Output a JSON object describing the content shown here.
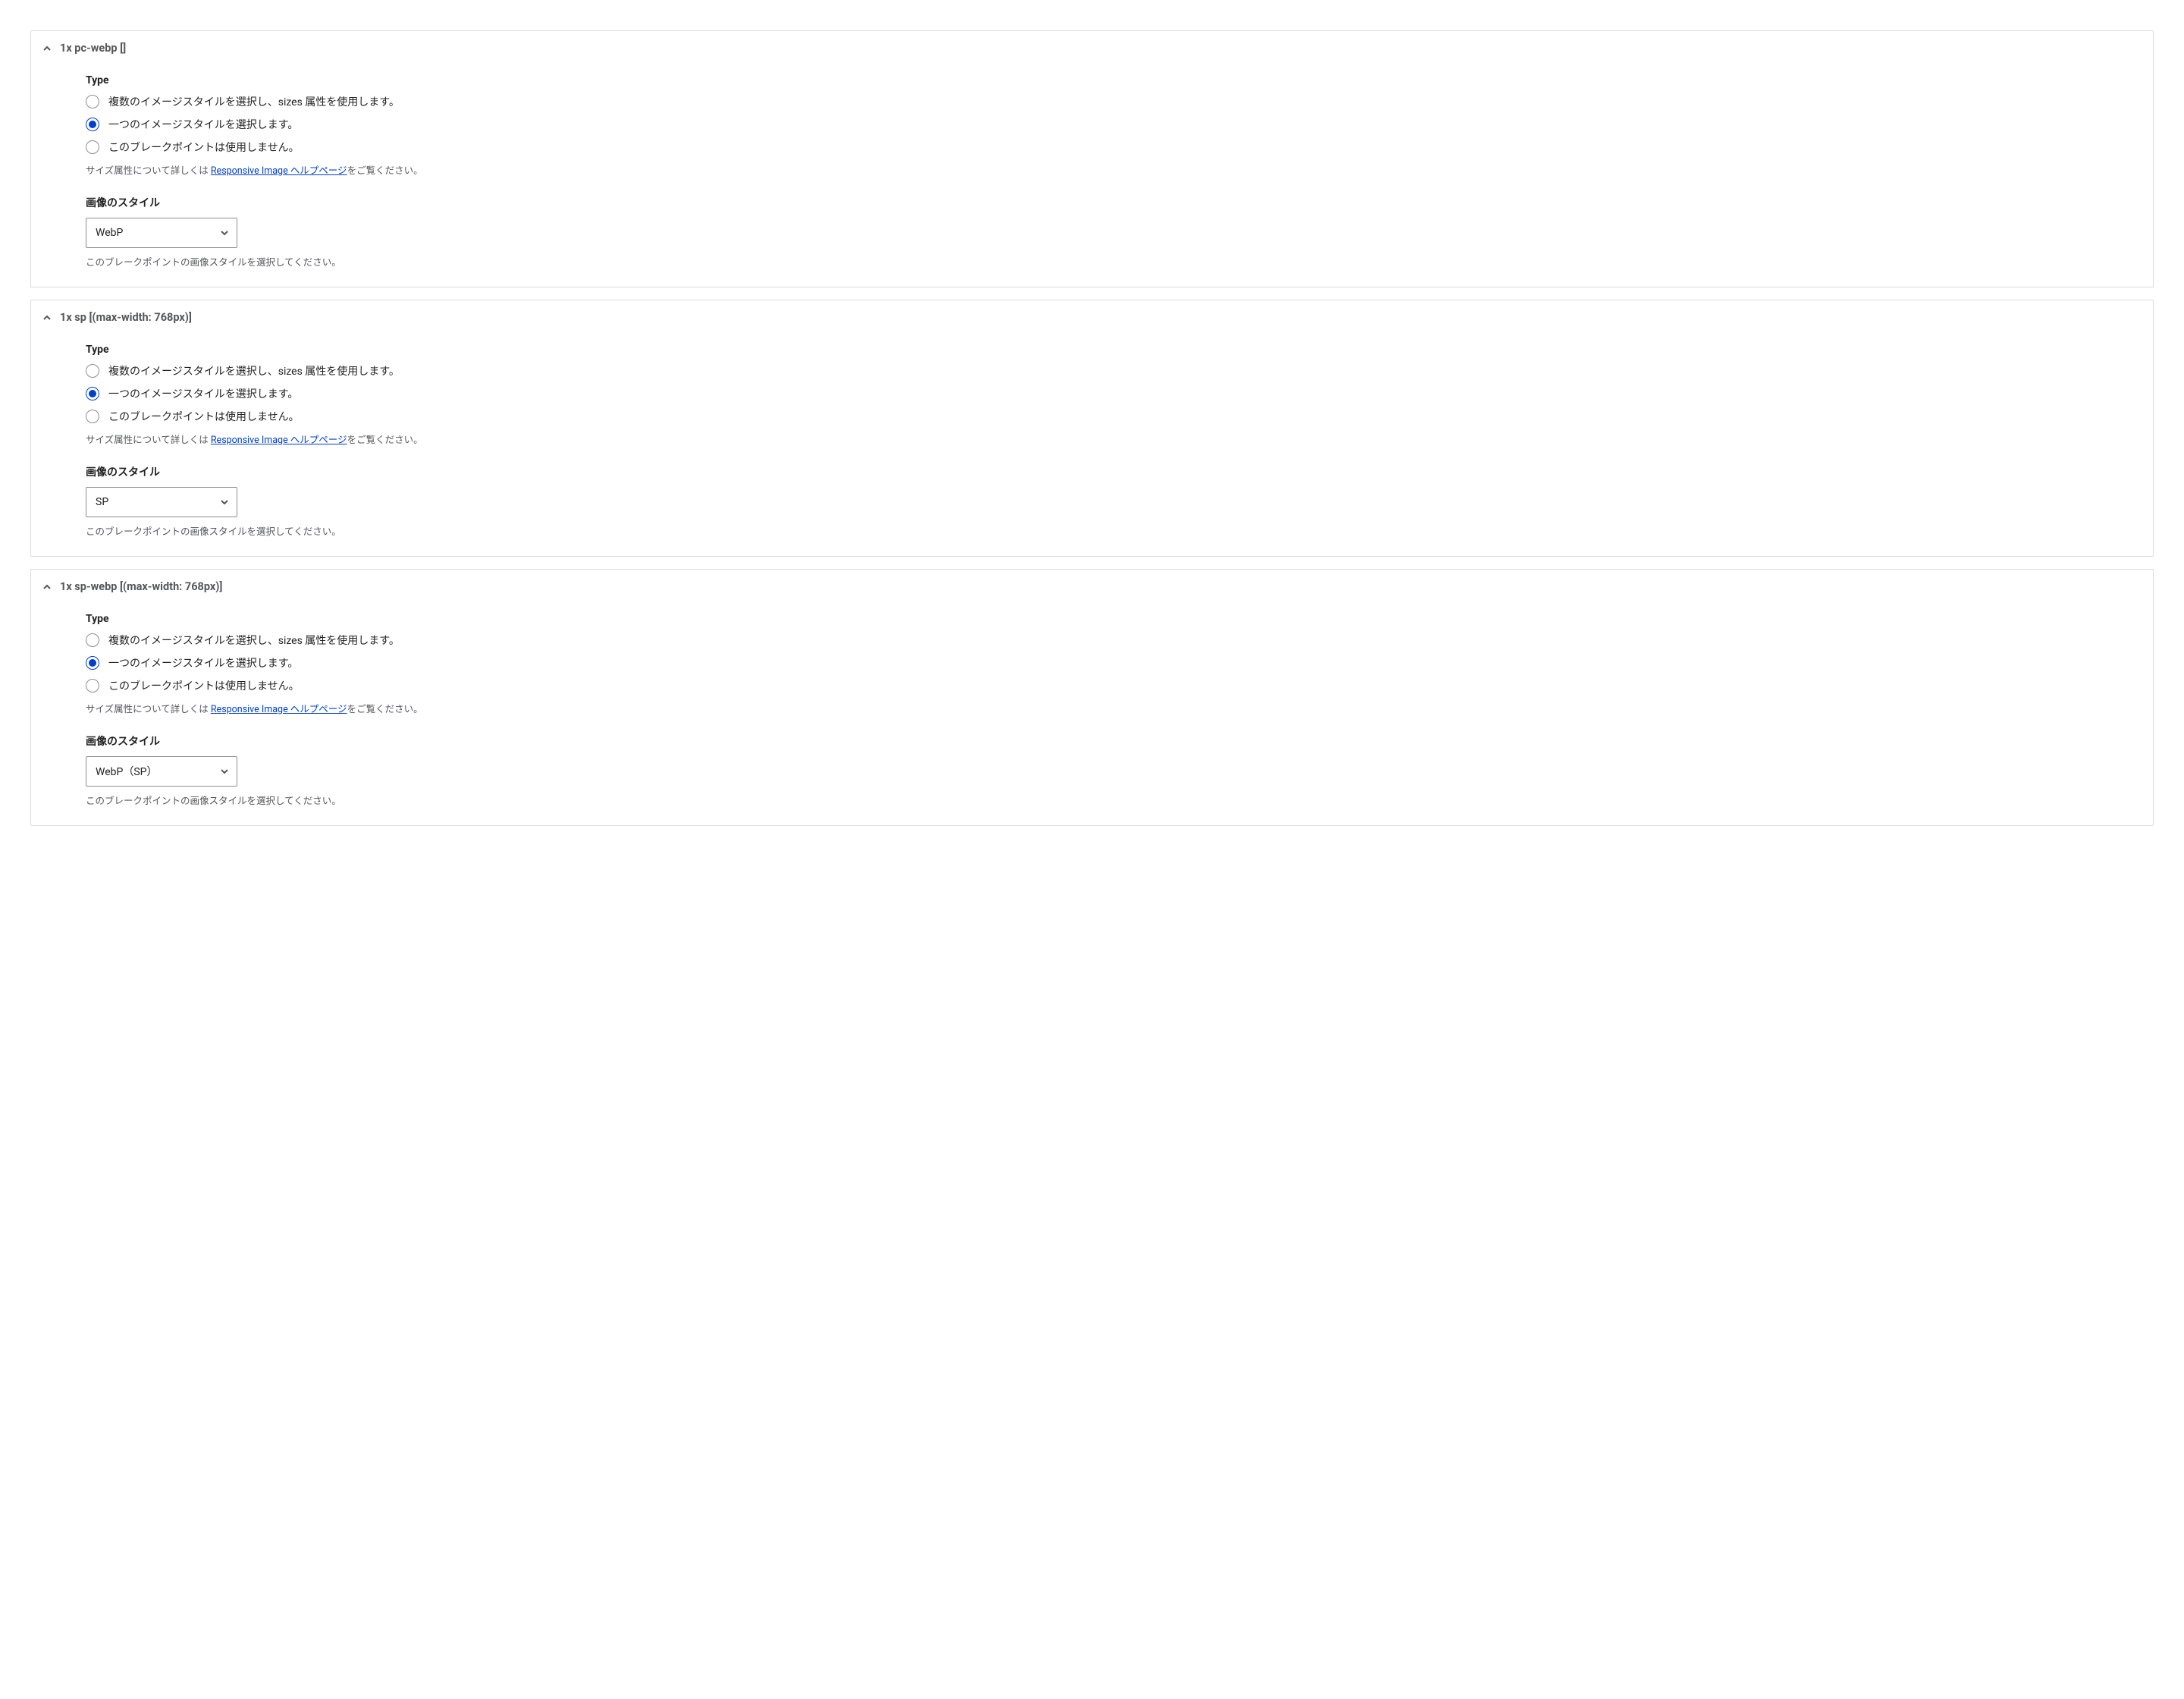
{
  "sections": [
    {
      "title": "1x pc-webp []",
      "type_label": "Type",
      "options": [
        "複数のイメージスタイルを選択し、sizes 属性を使用します。",
        "一つのイメージスタイルを選択します。",
        "このブレークポイントは使用しません。"
      ],
      "selected_option_index": 1,
      "help_prefix": "サイズ属性について詳しくは ",
      "help_link": "Responsive Image ヘルプページ",
      "help_suffix": "をご覧ください。",
      "style_label": "画像のスタイル",
      "style_value": "WebP",
      "style_help": "このブレークポイントの画像スタイルを選択してください。"
    },
    {
      "title": "1x sp [(max-width: 768px)]",
      "type_label": "Type",
      "options": [
        "複数のイメージスタイルを選択し、sizes 属性を使用します。",
        "一つのイメージスタイルを選択します。",
        "このブレークポイントは使用しません。"
      ],
      "selected_option_index": 1,
      "help_prefix": "サイズ属性について詳しくは ",
      "help_link": "Responsive Image ヘルプページ",
      "help_suffix": "をご覧ください。",
      "style_label": "画像のスタイル",
      "style_value": "SP",
      "style_help": "このブレークポイントの画像スタイルを選択してください。"
    },
    {
      "title": "1x sp-webp [(max-width: 768px)]",
      "type_label": "Type",
      "options": [
        "複数のイメージスタイルを選択し、sizes 属性を使用します。",
        "一つのイメージスタイルを選択します。",
        "このブレークポイントは使用しません。"
      ],
      "selected_option_index": 1,
      "help_prefix": "サイズ属性について詳しくは ",
      "help_link": "Responsive Image ヘルプページ",
      "help_suffix": "をご覧ください。",
      "style_label": "画像のスタイル",
      "style_value": "WebP（SP）",
      "style_help": "このブレークポイントの画像スタイルを選択してください。"
    }
  ]
}
